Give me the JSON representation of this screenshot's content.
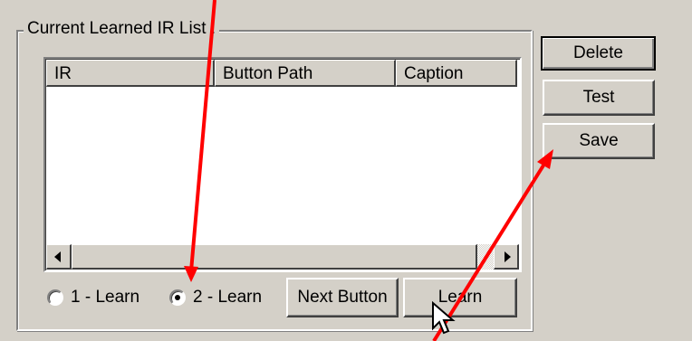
{
  "group": {
    "title": "Current Learned IR List :"
  },
  "list": {
    "columns": [
      "IR",
      "Button Path",
      "Caption"
    ],
    "rows": []
  },
  "buttons": {
    "delete": "Delete",
    "test": "Test",
    "save": "Save",
    "next": "Next Button",
    "learn": "Learn"
  },
  "radios": [
    {
      "label": "1 - Learn",
      "checked": false
    },
    {
      "label": "2 - Learn",
      "checked": true
    }
  ],
  "colors": {
    "annotation": "#ff0000",
    "face": "#d4d0c8"
  }
}
